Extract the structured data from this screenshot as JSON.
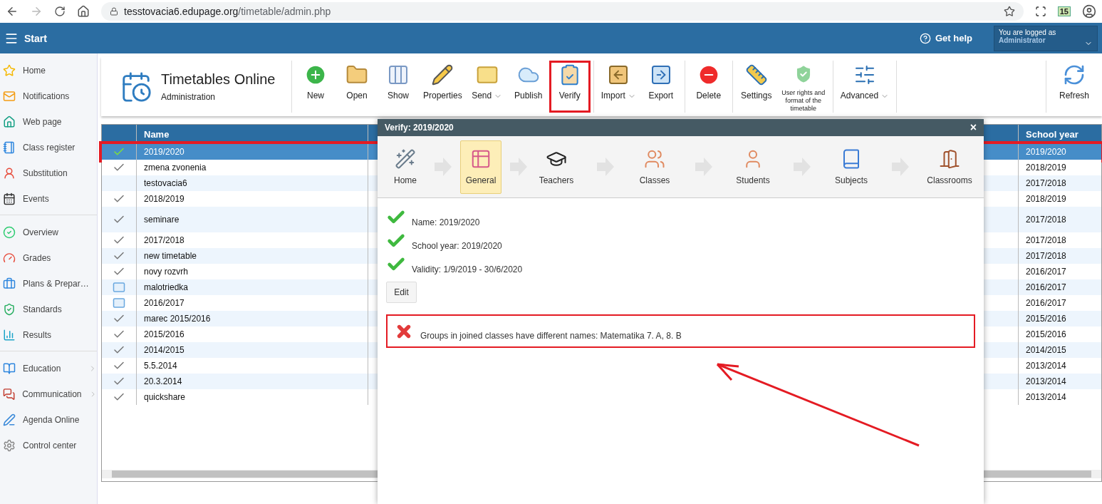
{
  "browser": {
    "url_host": "tesstovacia6.edupage.org",
    "url_path": "/timetable/admin.php",
    "extension_badge": "15"
  },
  "header": {
    "menu_label": "Start",
    "help": "Get help",
    "login_caption": "You are logged as",
    "login_user": "Administrator"
  },
  "sidebar": {
    "groups": [
      [
        {
          "label": "Home",
          "has_submenu": false
        },
        {
          "label": "Notifications",
          "has_submenu": false
        },
        {
          "label": "Web page",
          "has_submenu": false
        },
        {
          "label": "Class register",
          "has_submenu": false
        },
        {
          "label": "Substitution",
          "has_submenu": false
        },
        {
          "label": "Events",
          "has_submenu": false
        }
      ],
      [
        {
          "label": "Overview",
          "has_submenu": false
        },
        {
          "label": "Grades",
          "has_submenu": false
        },
        {
          "label": "Plans & Prepar…",
          "has_submenu": false
        },
        {
          "label": "Standards",
          "has_submenu": false
        },
        {
          "label": "Results",
          "has_submenu": false
        }
      ],
      [
        {
          "label": "Education",
          "has_submenu": true
        },
        {
          "label": "Communication",
          "has_submenu": true
        },
        {
          "label": "Agenda Online",
          "has_submenu": false
        },
        {
          "label": "Control center",
          "has_submenu": false
        }
      ]
    ]
  },
  "app": {
    "title": "Timetables Online",
    "subtitle": "Administration"
  },
  "toolbar": {
    "groups": [
      [
        {
          "label": "New",
          "dropdown": false,
          "highlighted": false
        },
        {
          "label": "Open",
          "dropdown": false,
          "highlighted": false
        },
        {
          "label": "Show",
          "dropdown": false,
          "highlighted": false
        },
        {
          "label": "Properties",
          "dropdown": false,
          "highlighted": false
        },
        {
          "label": "Send",
          "dropdown": true,
          "highlighted": false
        },
        {
          "label": "Publish",
          "dropdown": false,
          "highlighted": false
        },
        {
          "label": "Verify",
          "dropdown": false,
          "highlighted": true
        }
      ],
      [
        {
          "label": "Import",
          "dropdown": true,
          "highlighted": false
        },
        {
          "label": "Export",
          "dropdown": false,
          "highlighted": false
        }
      ],
      [
        {
          "label": "Delete",
          "dropdown": false,
          "highlighted": false
        }
      ],
      [
        {
          "label": "Settings",
          "dropdown": false,
          "highlighted": false
        },
        {
          "label": "User rights and format of the timetable",
          "dropdown": false,
          "highlighted": false
        }
      ],
      [
        {
          "label": "Advanced",
          "dropdown": true,
          "highlighted": false
        }
      ]
    ],
    "refresh": "Refresh"
  },
  "table": {
    "columns": [
      "Name",
      "School year"
    ],
    "rows": [
      {
        "kind": "check",
        "name": "2019/2020",
        "school_year": "2019/2020",
        "selected": true,
        "highlighted": true,
        "tall": false
      },
      {
        "kind": "check",
        "name": "zmena zvonenia",
        "school_year": "2018/2019",
        "selected": false,
        "highlighted": false,
        "tall": false
      },
      {
        "kind": "none",
        "name": "testovacia6",
        "school_year": "2017/2018",
        "selected": false,
        "highlighted": false,
        "tall": false
      },
      {
        "kind": "check",
        "name": "2018/2019",
        "school_year": "2018/2019",
        "selected": false,
        "highlighted": false,
        "tall": false
      },
      {
        "kind": "check",
        "name": "seminare",
        "school_year": "2017/2018",
        "selected": false,
        "highlighted": false,
        "tall": true
      },
      {
        "kind": "check",
        "name": "2017/2018",
        "school_year": "2017/2018",
        "selected": false,
        "highlighted": false,
        "tall": false
      },
      {
        "kind": "check",
        "name": "new timetable",
        "school_year": "2017/2018",
        "selected": false,
        "highlighted": false,
        "tall": false
      },
      {
        "kind": "check",
        "name": "novy rozvrh",
        "school_year": "2016/2017",
        "selected": false,
        "highlighted": false,
        "tall": false
      },
      {
        "kind": "mail",
        "name": "malotriedka",
        "school_year": "2016/2017",
        "selected": false,
        "highlighted": false,
        "tall": false
      },
      {
        "kind": "mail",
        "name": "2016/2017",
        "school_year": "2016/2017",
        "selected": false,
        "highlighted": false,
        "tall": false
      },
      {
        "kind": "check",
        "name": "marec 2015/2016",
        "school_year": "2015/2016",
        "selected": false,
        "highlighted": false,
        "tall": false
      },
      {
        "kind": "check",
        "name": "2015/2016",
        "school_year": "2015/2016",
        "selected": false,
        "highlighted": false,
        "tall": false
      },
      {
        "kind": "check",
        "name": "2014/2015",
        "school_year": "2014/2015",
        "selected": false,
        "highlighted": false,
        "tall": false
      },
      {
        "kind": "check",
        "name": "5.5.2014",
        "school_year": "2013/2014",
        "selected": false,
        "highlighted": false,
        "tall": false
      },
      {
        "kind": "check",
        "name": "20.3.2014",
        "school_year": "2013/2014",
        "selected": false,
        "highlighted": false,
        "tall": false
      },
      {
        "kind": "check",
        "name": "quickshare",
        "school_year": "2013/2014",
        "selected": false,
        "highlighted": false,
        "tall": false
      }
    ]
  },
  "dialog": {
    "title": "Verify: 2019/2020",
    "close": "×",
    "steps": [
      {
        "label": "Home",
        "selected": false
      },
      {
        "label": "General",
        "selected": true
      },
      {
        "label": "Teachers",
        "selected": false
      },
      {
        "label": "Classes",
        "selected": false
      },
      {
        "label": "Students",
        "selected": false
      },
      {
        "label": "Subjects",
        "selected": false
      },
      {
        "label": "Classrooms",
        "selected": false
      }
    ],
    "results": [
      {
        "kind": "ok",
        "text": "Name: 2019/2020"
      },
      {
        "kind": "ok",
        "text": "School year: 2019/2020"
      },
      {
        "kind": "ok",
        "text": "Validity: 1/9/2019 - 30/6/2020"
      }
    ],
    "edit_button": "Edit",
    "errors": [
      {
        "text": "Groups in joined classes have different names: Matematika 7. A, 8. B",
        "highlighted": true
      }
    ]
  }
}
